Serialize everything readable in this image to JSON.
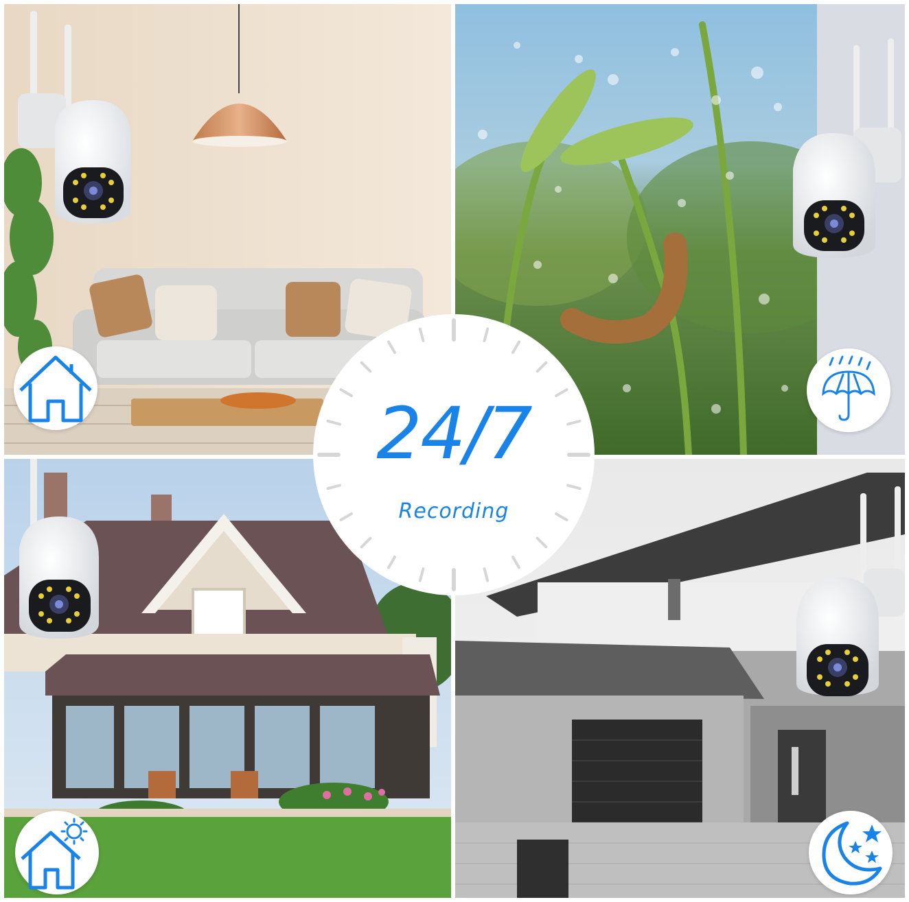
{
  "headline": "24/7",
  "subheadline": "Recording",
  "accent_color": "#1a83e8",
  "scenes": [
    {
      "id": "indoor-living-room",
      "icon": "home-icon"
    },
    {
      "id": "rain-outdoor",
      "icon": "umbrella-rain-icon"
    },
    {
      "id": "daytime-house",
      "icon": "home-sun-icon"
    },
    {
      "id": "night-garage",
      "icon": "moon-stars-icon"
    }
  ]
}
